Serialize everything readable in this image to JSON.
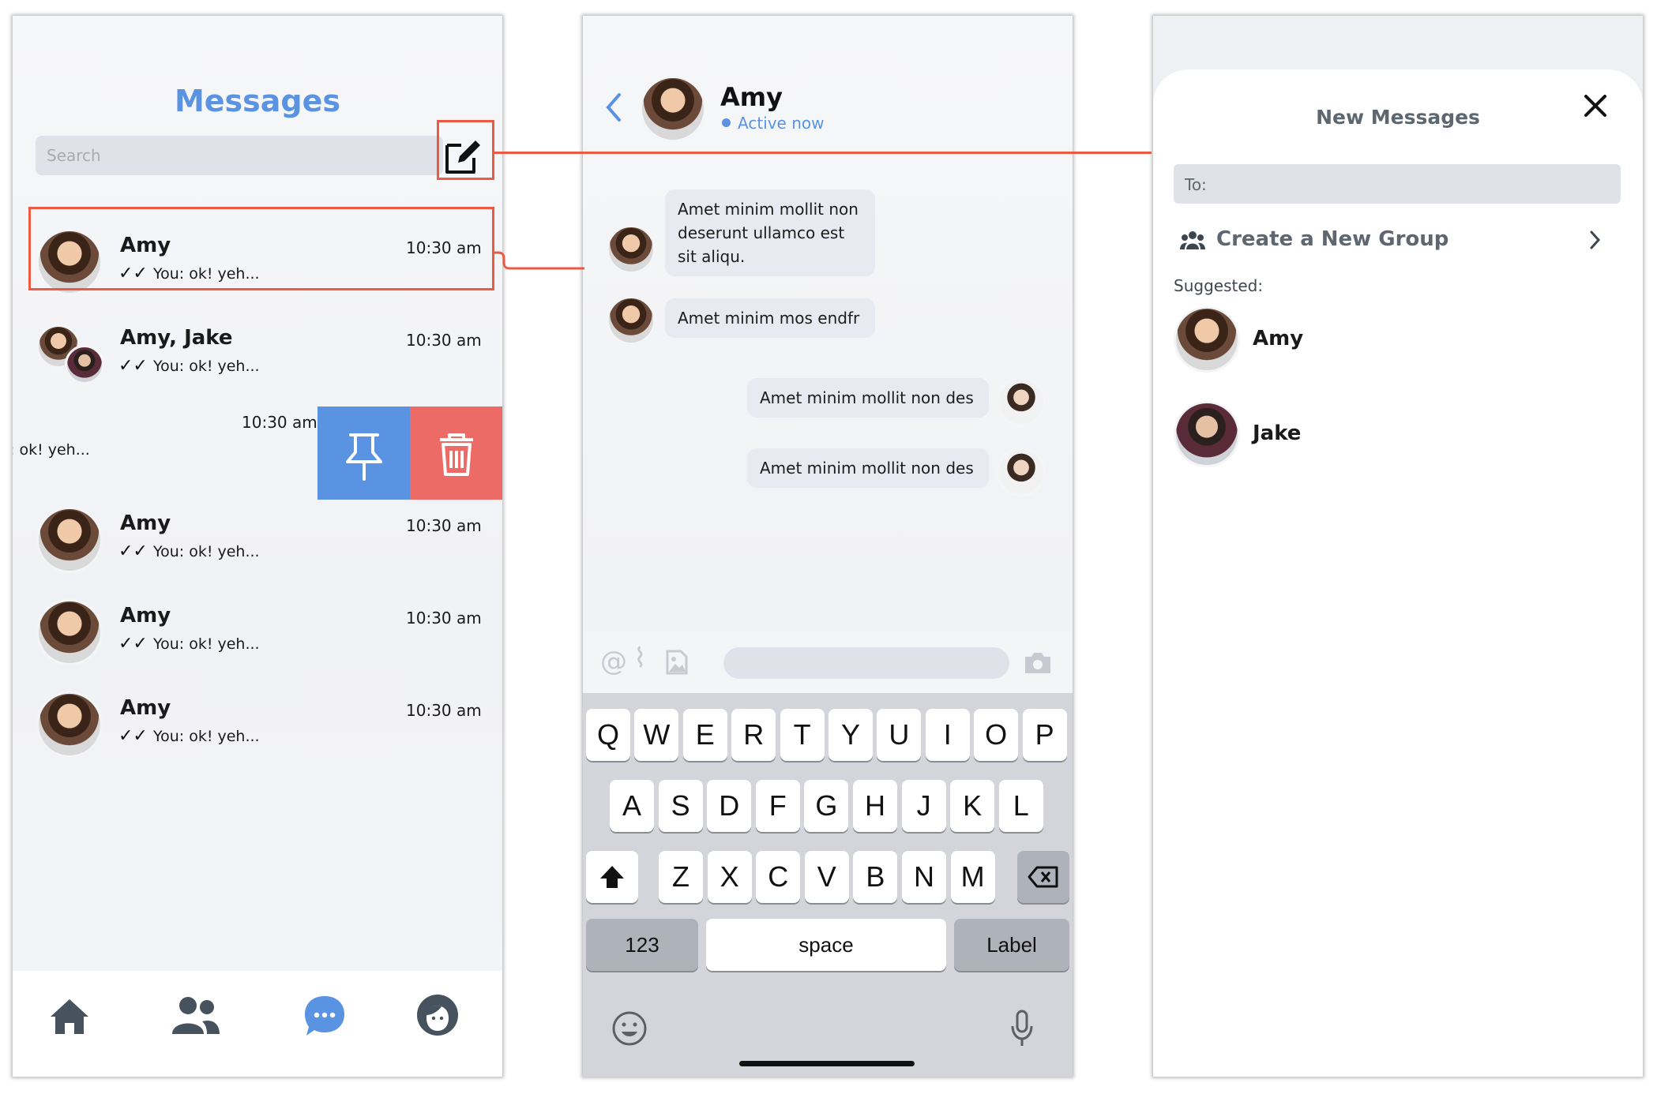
{
  "list": {
    "title": "Messages",
    "search_placeholder": "Search",
    "conversations": [
      {
        "name": "Amy",
        "time": "10:30 am",
        "preview": "You: ok! yeh..."
      },
      {
        "name": "Amy, Jake",
        "time": "10:30 am",
        "preview": "You: ok! yeh..."
      },
      {
        "name": "",
        "time": "10:30 am",
        "preview": ": ok! yeh..."
      },
      {
        "name": "Amy",
        "time": "10:30 am",
        "preview": "You: ok! yeh..."
      },
      {
        "name": "Amy",
        "time": "10:30 am",
        "preview": "You: ok! yeh..."
      },
      {
        "name": "Amy",
        "time": "10:30 am",
        "preview": "You: ok! yeh..."
      }
    ],
    "swipe_actions": {
      "pin_color": "#5b93e3",
      "delete_color": "#ec6b67"
    },
    "nav": [
      "home-icon",
      "friends-icon",
      "chat-icon",
      "profile-icon"
    ],
    "accent": "#5b93e3"
  },
  "chat": {
    "contact_name": "Amy",
    "status": "Active now",
    "messages": [
      {
        "from": "them",
        "text_lines": [
          "Amet minim mollit non",
          "deserunt ullamco est",
          "sit aliqu."
        ]
      },
      {
        "from": "them",
        "text_lines": [
          "Amet minim mos endfr"
        ]
      },
      {
        "from": "me",
        "text_lines": [
          "Amet minim mollit non des"
        ]
      },
      {
        "from": "me",
        "text_lines": [
          "Amet minim mollit non des"
        ]
      }
    ],
    "keyboard": {
      "row1": [
        "Q",
        "W",
        "E",
        "R",
        "T",
        "Y",
        "U",
        "I",
        "O",
        "P"
      ],
      "row2": [
        "A",
        "S",
        "D",
        "F",
        "G",
        "H",
        "J",
        "K",
        "L"
      ],
      "row3": [
        "Z",
        "X",
        "C",
        "V",
        "B",
        "N",
        "M"
      ],
      "numbers_key": "123",
      "space_key": "space",
      "return_key": "Label"
    }
  },
  "new_message": {
    "title": "New Messages",
    "to_label": "To:",
    "create_group": "Create a New Group",
    "suggested_label": "Suggested:",
    "suggested": [
      {
        "name": "Amy"
      },
      {
        "name": "Jake"
      }
    ]
  },
  "annotation_color": "#ec5a44"
}
